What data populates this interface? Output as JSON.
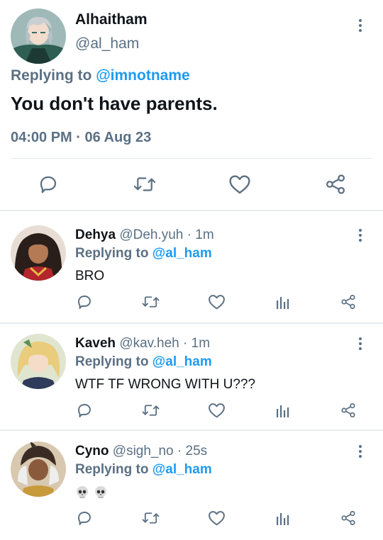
{
  "main_tweet": {
    "author_name": "Alhaitham",
    "author_handle": "@al_ham",
    "replying_prefix": "Replying to",
    "replying_to": "@imnotname",
    "text": "You don't have parents.",
    "timestamp": "04:00 PM · 06 Aug 23",
    "actions": [
      "reply-icon",
      "retweet-icon",
      "like-icon",
      "share-icon"
    ]
  },
  "replies": [
    {
      "name": "Dehya",
      "meta": "@Deh.yuh · 1m",
      "replying_prefix": "Replying to",
      "replying_to": "@al_ham",
      "text": "BRO"
    },
    {
      "name": "Kaveh",
      "meta": "@kav.heh · 1m",
      "replying_prefix": "Replying to",
      "replying_to": "@al_ham",
      "text": "WTF TF WRONG WITH U???"
    },
    {
      "name": "Cyno",
      "meta": "@sigh_no · 25s",
      "replying_prefix": "Replying to",
      "replying_to": "@al_ham",
      "text": "skull-emoji skull-emoji"
    }
  ],
  "colors": {
    "text": "#0f1419",
    "secondary": "#5b7083",
    "link": "#1d9bf0",
    "divider": "#e1e8ed"
  }
}
